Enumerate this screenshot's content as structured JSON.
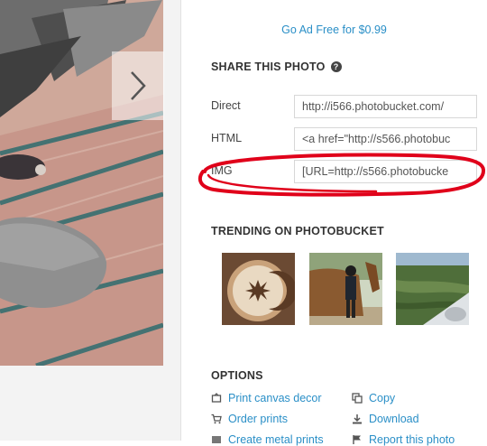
{
  "promo": {
    "go_ad_free": "Go Ad Free for $0.99"
  },
  "share": {
    "title": "SHARE THIS PHOTO",
    "help_icon": "?",
    "rows": [
      {
        "label": "Direct",
        "value": "http://i566.photobucket.com/"
      },
      {
        "label": "HTML",
        "value": "<a href=\"http://s566.photobuc"
      },
      {
        "label": "IMG",
        "value": "[URL=http://s566.photobucke"
      }
    ]
  },
  "trending": {
    "title": "TRENDING ON PHOTOBUCKET",
    "thumbnails": [
      "latte-art-moon-thumbnail",
      "girl-with-horse-thumbnail",
      "airplane-wing-aerial-thumbnail"
    ]
  },
  "options": {
    "title": "OPTIONS",
    "items": [
      {
        "label": "Print canvas decor",
        "icon": "canvas-icon"
      },
      {
        "label": "Copy",
        "icon": "copy-icon"
      },
      {
        "label": "Order prints",
        "icon": "cart-icon"
      },
      {
        "label": "Download",
        "icon": "download-icon"
      },
      {
        "label": "Create metal prints",
        "icon": "metal-print-icon"
      },
      {
        "label": "Report this photo",
        "icon": "flag-icon"
      }
    ]
  },
  "colors": {
    "link": "#2a8fc7",
    "annotation": "#e0001a"
  }
}
